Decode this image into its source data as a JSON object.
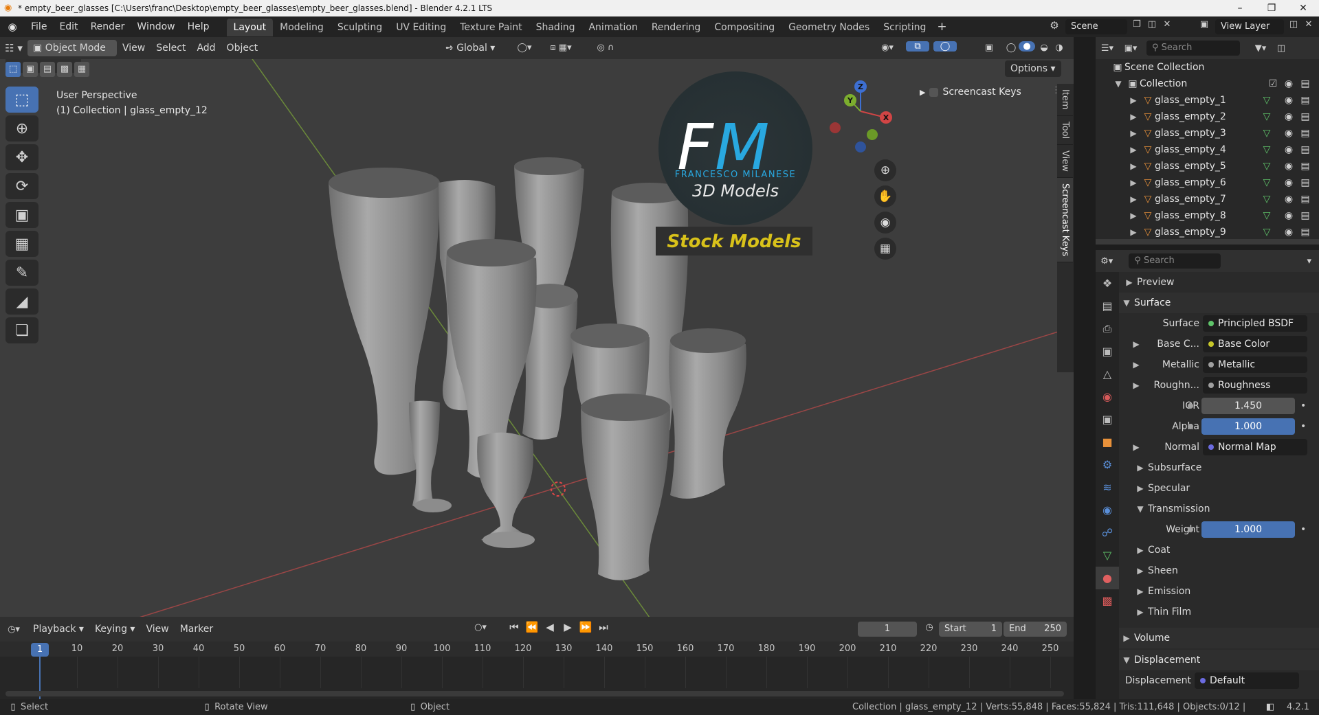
{
  "window": {
    "title": "* empty_beer_glasses [C:\\Users\\franc\\Desktop\\empty_beer_glasses\\empty_beer_glasses.blend] - Blender 4.2.1 LTS"
  },
  "menu": [
    "File",
    "Edit",
    "Render",
    "Window",
    "Help"
  ],
  "workspaces": [
    "Layout",
    "Modeling",
    "Sculpting",
    "UV Editing",
    "Texture Paint",
    "Shading",
    "Animation",
    "Rendering",
    "Compositing",
    "Geometry Nodes",
    "Scripting"
  ],
  "scene": {
    "name": "Scene",
    "view_layer": "View Layer"
  },
  "viewport_header": {
    "mode": "Object Mode",
    "menus": [
      "View",
      "Select",
      "Add",
      "Object"
    ],
    "transform": "Global",
    "options": "Options"
  },
  "viewport": {
    "perspective": "User Perspective",
    "collection_info": "(1) Collection | glass_empty_12",
    "screencast_keys": "Screencast Keys",
    "side_tabs": [
      "Item",
      "Tool",
      "View",
      "Screencast Keys"
    ],
    "gizmo_axes": [
      "Z",
      "Y",
      "X"
    ],
    "watermark": {
      "monogram": "FM",
      "name": "FRANCESCO MILANESE",
      "tagline": "3D Models",
      "banner": "Stock Models"
    }
  },
  "outliner": {
    "search_placeholder": "Search",
    "scene_collection": "Scene Collection",
    "collection": "Collection",
    "items": [
      "glass_empty_1",
      "glass_empty_2",
      "glass_empty_3",
      "glass_empty_4",
      "glass_empty_5",
      "glass_empty_6",
      "glass_empty_7",
      "glass_empty_8",
      "glass_empty_9"
    ]
  },
  "properties": {
    "search_placeholder": "Search",
    "preview": "Preview",
    "surface_section": "Surface",
    "surface": {
      "label": "Surface",
      "value": "Principled BSDF"
    },
    "base_color": {
      "label": "Base C...",
      "value": "Base Color"
    },
    "metallic": {
      "label": "Metallic",
      "value": "Metallic"
    },
    "roughness": {
      "label": "Roughn...",
      "value": "Roughness"
    },
    "ior": {
      "label": "IOR",
      "value": "1.450"
    },
    "alpha": {
      "label": "Alpha",
      "value": "1.000"
    },
    "normal": {
      "label": "Normal",
      "value": "Normal Map"
    },
    "subsurface": "Subsurface",
    "specular": "Specular",
    "transmission": "Transmission",
    "weight": {
      "label": "Weight",
      "value": "1.000"
    },
    "coat": "Coat",
    "sheen": "Sheen",
    "emission": "Emission",
    "thin_film": "Thin Film",
    "volume": "Volume",
    "displacement_section": "Displacement",
    "displacement": {
      "label": "Displacement",
      "value": "Default"
    }
  },
  "timeline": {
    "menus": [
      "Playback",
      "Keying",
      "View",
      "Marker"
    ],
    "current_frame": "1",
    "start_label": "Start",
    "start": "1",
    "end_label": "End",
    "end": "250",
    "ticks": [
      "10",
      "20",
      "30",
      "40",
      "50",
      "60",
      "70",
      "80",
      "90",
      "100",
      "110",
      "120",
      "130",
      "140",
      "150",
      "160",
      "170",
      "180",
      "190",
      "200",
      "210",
      "220",
      "230",
      "240",
      "250"
    ]
  },
  "statusbar": {
    "select": "Select",
    "rotate": "Rotate View",
    "object": "Object",
    "stats": "Collection | glass_empty_12 | Verts:55,848 | Faces:55,824 | Tris:111,648 | Objects:0/12 |",
    "version": "4.2.1"
  },
  "colors": {
    "accent": "#4772b3",
    "viewport_bg": "#3d3d3d",
    "watermark_blue": "#29a8e0",
    "banner_text": "#d9c21a"
  }
}
